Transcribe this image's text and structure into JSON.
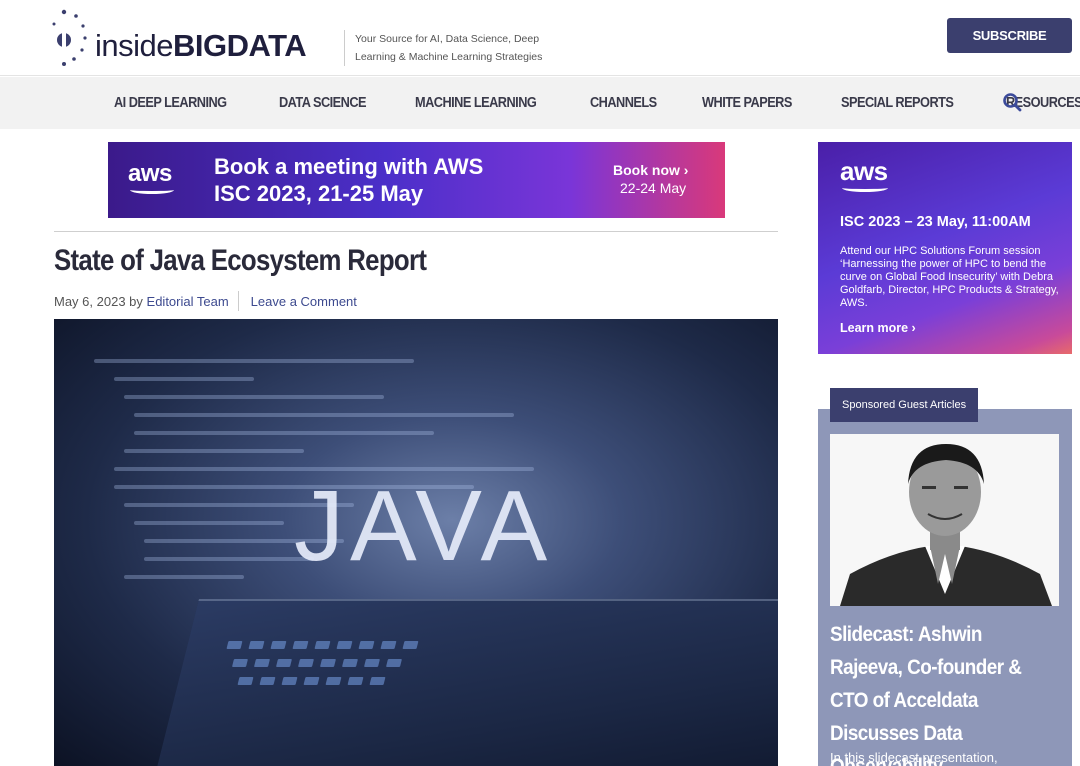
{
  "header": {
    "logo_prefix": "inside",
    "logo_bold": "BIGDATA",
    "tagline": "Your Source for AI, Data Science, Deep Learning & Machine Learning Strategies",
    "subscribe_label": "SUBSCRIBE"
  },
  "nav": {
    "items": [
      {
        "label": "AI DEEP LEARNING"
      },
      {
        "label": "DATA SCIENCE"
      },
      {
        "label": "MACHINE LEARNING"
      },
      {
        "label": "CHANNELS"
      },
      {
        "label": "WHITE PAPERS"
      },
      {
        "label": "SPECIAL REPORTS"
      },
      {
        "label": "RESOURCES"
      }
    ],
    "search_icon": "search-icon"
  },
  "banner": {
    "brand": "aws",
    "line1": "Book a meeting with AWS",
    "line2": "ISC 2023, 21-25 May",
    "cta": "Book now ›",
    "cta_dates": "22-24 May"
  },
  "article": {
    "title": "State of Java Ecosystem Report",
    "date": "May 6, 2023",
    "by": "by",
    "author": "Editorial Team",
    "comment_link": "Leave a Comment",
    "hero_text": "JAVA"
  },
  "sidebar_ad": {
    "brand": "aws",
    "title": "ISC 2023 – 23 May, 11:00AM",
    "body": "Attend our HPC Solutions Forum session ‘Harnessing the power of HPC to bend the curve on Global Food Insecurity’ with Debra Goldfarb, Director, HPC Products & Strategy, AWS.",
    "link": "Learn more ›"
  },
  "sponsored": {
    "tab_label": "Sponsored Guest Articles",
    "headline": "Slidecast: Ashwin Rajeeva, Co-founder & CTO of Acceldata Discusses Data Observability",
    "excerpt": "In this slidecast presentation,"
  }
}
